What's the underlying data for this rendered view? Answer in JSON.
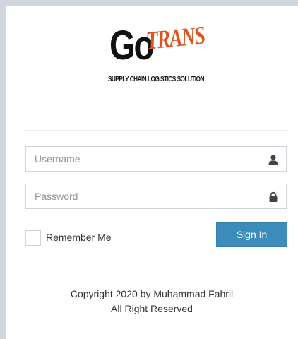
{
  "logo": {
    "brand_go": "Go",
    "brand_trans": "TRANS",
    "tagline": "SUPPLY CHAIN LOGISTICS SOLUTION"
  },
  "form": {
    "username_placeholder": "Username",
    "password_placeholder": "Password",
    "remember_label": "Remember Me",
    "remember_checked": false,
    "signin_label": "Sign In"
  },
  "footer": {
    "copyright": "Copyright 2020 by Muhammad Fahril",
    "rights": "All Right Reserved"
  },
  "colors": {
    "accent": "#3c8dbc",
    "logo_orange": "#e0531f"
  },
  "icons": {
    "username": "user-icon",
    "password": "lock-icon"
  }
}
